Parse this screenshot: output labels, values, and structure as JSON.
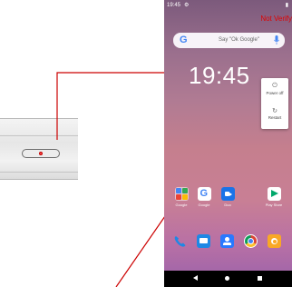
{
  "status_bar": {
    "time": "19:45",
    "settings_icon": "gear-icon",
    "battery_icon": "battery-icon"
  },
  "warning": "Not Verify",
  "search": {
    "logo": "G",
    "hint": "Say \"Ok Google\"",
    "mic_icon": "mic-icon"
  },
  "clock": {
    "time": "19:45"
  },
  "power_menu": {
    "items": [
      {
        "label": "Power off",
        "icon": "power-icon"
      },
      {
        "label": "Restart",
        "icon": "restart-icon"
      }
    ]
  },
  "apps": [
    {
      "label": "Google",
      "icon": "google-folder-icon"
    },
    {
      "label": "Google",
      "icon": "google-icon"
    },
    {
      "label": "Duo",
      "icon": "duo-icon"
    },
    {
      "label": "Play Store",
      "icon": "play-store-icon"
    }
  ],
  "dock": [
    {
      "icon": "phone-icon"
    },
    {
      "icon": "messages-icon"
    },
    {
      "icon": "contacts-icon"
    },
    {
      "icon": "chrome-icon"
    },
    {
      "icon": "camera-icon"
    }
  ],
  "nav": {
    "back_icon": "back-icon",
    "home_icon": "home-icon",
    "recents_icon": "recents-icon"
  },
  "colors": {
    "warning": "#e00000",
    "callout": "#cc0000",
    "google_blue": "#4285f4"
  }
}
